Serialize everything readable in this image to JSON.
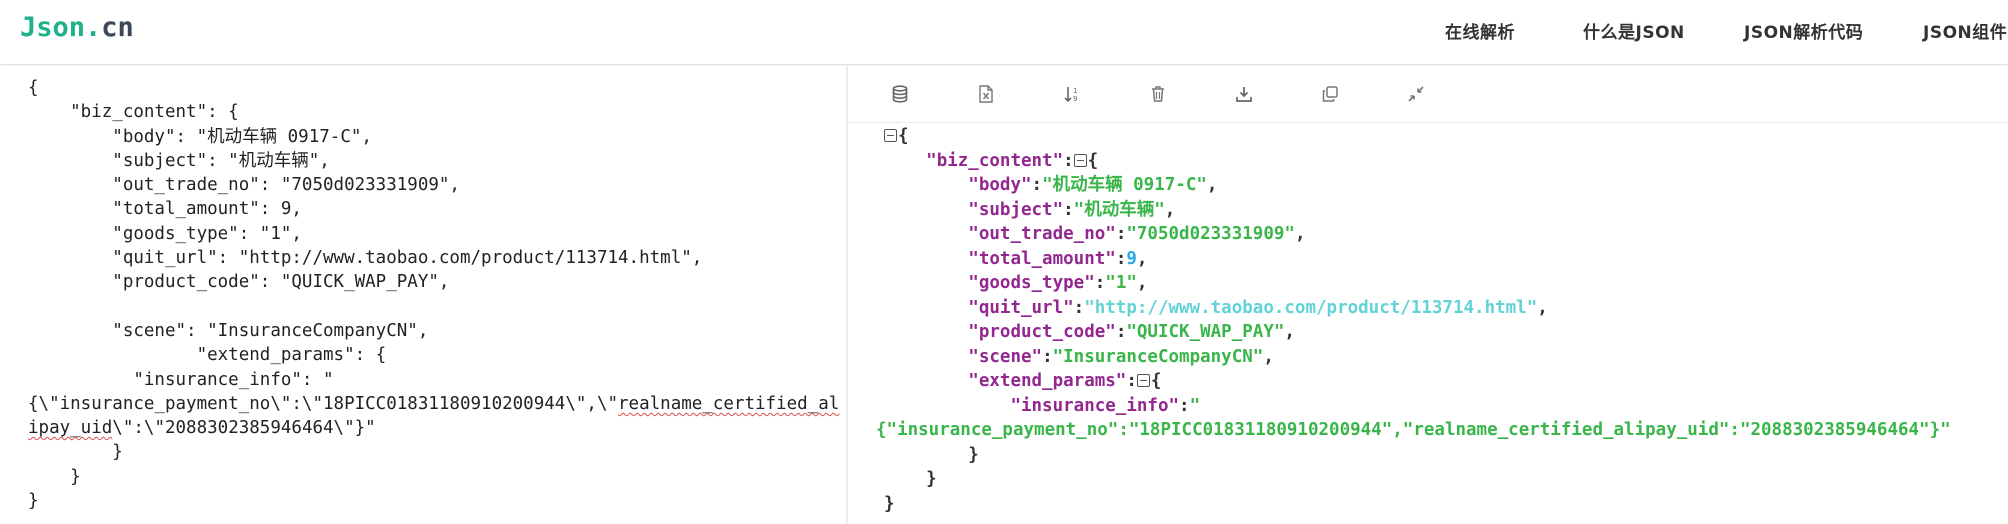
{
  "header": {
    "logo": {
      "part1": "Json",
      "dot": ".",
      "part2": "cn"
    },
    "nav": [
      "在线解析",
      "什么是JSON",
      "JSON解析代码",
      "JSON组件"
    ]
  },
  "toolbar": {
    "icons": [
      "database-icon",
      "excel-icon",
      "sort-icon",
      "trash-icon",
      "download-icon",
      "copy-icon",
      "compress-icon"
    ]
  },
  "raw_input": {
    "lines": [
      "{",
      "    \"biz_content\": {",
      "        \"body\": \"机动车辆 0917-C\",",
      "        \"subject\": \"机动车辆\",",
      "        \"out_trade_no\": \"7050d023331909\",",
      "        \"total_amount\": 9,",
      "        \"goods_type\": \"1\",",
      "        \"quit_url\": \"http://www.taobao.com/product/113714.html\",",
      "        \"product_code\": \"QUICK_WAP_PAY\",",
      "",
      "        \"scene\": \"InsuranceCompanyCN\",",
      "                \"extend_params\": {",
      "          \"insurance_info\": \"",
      "{\\\"insurance_payment_no\\\":\\\"18PICC01831180910200944\\\",\\\"",
      "ipay_uid\\\":\\\"2088302385946464\\\"}\"",
      "        }",
      "    }",
      "}"
    ],
    "wrap_tail_line13": "realname_certified_al",
    "wrap_head_line14": "ipay_uid"
  },
  "formatted": {
    "biz_content_key": "\"biz_content\"",
    "entries": [
      {
        "key": "\"body\"",
        "value": "\"机动车辆 0917-C\"",
        "type": "str"
      },
      {
        "key": "\"subject\"",
        "value": "\"机动车辆\"",
        "type": "str"
      },
      {
        "key": "\"out_trade_no\"",
        "value": "\"7050d023331909\"",
        "type": "str"
      },
      {
        "key": "\"total_amount\"",
        "value": "9",
        "type": "num"
      },
      {
        "key": "\"goods_type\"",
        "value": "\"1\"",
        "type": "str"
      },
      {
        "key": "\"quit_url\"",
        "value": "\"http://www.taobao.com/product/113714.html\"",
        "type": "url"
      },
      {
        "key": "\"product_code\"",
        "value": "\"QUICK_WAP_PAY\"",
        "type": "str"
      },
      {
        "key": "\"scene\"",
        "value": "\"InsuranceCompanyCN\"",
        "type": "str"
      }
    ],
    "extend_params_key": "\"extend_params\"",
    "insurance_info_key": "\"insurance_info\"",
    "insurance_info_open": "\"",
    "insurance_info_value": "{\"insurance_payment_no\":\"18PICC01831180910200944\",\"realname_certified_alipay_uid\":\"2088302385946464\"}\""
  },
  "colors": {
    "key": "#92278f",
    "string": "#3ab54a",
    "number": "#25aae2",
    "url": "#61d2d6",
    "logo_accent": "#1fb18a"
  }
}
